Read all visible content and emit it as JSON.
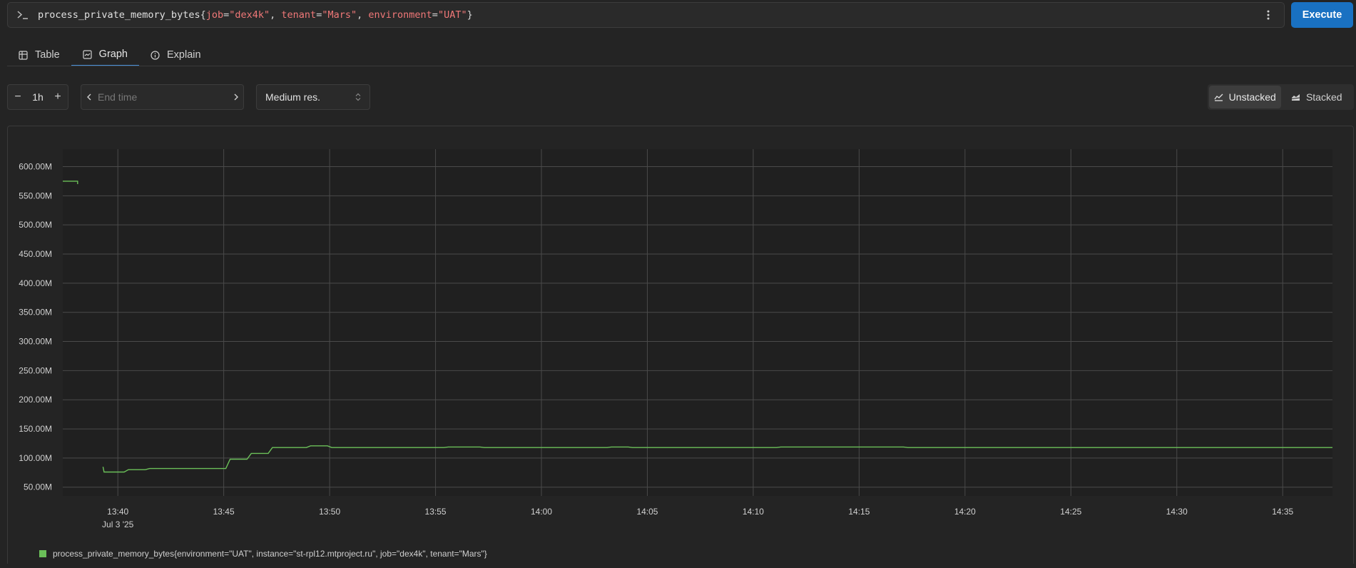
{
  "query": {
    "metric": "process_private_memory_bytes",
    "matchers": [
      {
        "key": "job",
        "value": "\"dex4k\""
      },
      {
        "key": "tenant",
        "value": "\"Mars\""
      },
      {
        "key": "environment",
        "value": "\"UAT\""
      }
    ]
  },
  "execute_label": "Execute",
  "tabs": [
    {
      "label": "Table",
      "icon": "table-icon"
    },
    {
      "label": "Graph",
      "icon": "graph-icon",
      "active": true
    },
    {
      "label": "Explain",
      "icon": "info-icon"
    }
  ],
  "controls": {
    "range": "1h",
    "end_time_placeholder": "End time",
    "resolution": "Medium res.",
    "unstacked_label": "Unstacked",
    "stacked_label": "Stacked"
  },
  "colors": {
    "accent": "#1971c2",
    "series": "#6bbf59"
  },
  "chart_data": {
    "type": "line",
    "y_ticks": [
      "50.00M",
      "100.00M",
      "150.00M",
      "200.00M",
      "250.00M",
      "300.00M",
      "350.00M",
      "400.00M",
      "450.00M",
      "500.00M",
      "550.00M",
      "600.00M"
    ],
    "y_tick_values": [
      50,
      100,
      150,
      200,
      250,
      300,
      350,
      400,
      450,
      500,
      550,
      600
    ],
    "ylim": [
      35,
      630
    ],
    "x_ticks": [
      "13:40",
      "13:45",
      "13:50",
      "13:55",
      "14:00",
      "14:05",
      "14:10",
      "14:15",
      "14:20",
      "14:25",
      "14:30",
      "14:35"
    ],
    "x_tick_minutes": [
      820,
      825,
      830,
      835,
      840,
      845,
      850,
      855,
      860,
      865,
      870,
      875
    ],
    "x_date_label": "Jul 3 '25",
    "xlim": [
      817.4,
      877.35
    ],
    "grid": true,
    "series": [
      {
        "name": "process_private_memory_bytes{environment=\"UAT\", instance=\"st-rpl12.mtproject.ru\", job=\"dex4k\", tenant=\"Mars\"}",
        "segments": [
          [
            [
              817.4,
              575
            ],
            [
              818.1,
              575
            ],
            [
              818.1,
              570
            ]
          ],
          [
            [
              819.3,
              85
            ],
            [
              819.35,
              76
            ],
            [
              820.3,
              76
            ],
            [
              820.5,
              80
            ],
            [
              821.3,
              80
            ],
            [
              821.5,
              82
            ],
            [
              825.1,
              82
            ],
            [
              825.3,
              98
            ],
            [
              826.1,
              98
            ],
            [
              826.3,
              108
            ],
            [
              827.1,
              108
            ],
            [
              827.3,
              118
            ],
            [
              828.9,
              118
            ],
            [
              829.1,
              121
            ],
            [
              829.9,
              121
            ],
            [
              830.1,
              118
            ],
            [
              835.4,
              118
            ],
            [
              835.6,
              119
            ],
            [
              837.1,
              119
            ],
            [
              837.3,
              118
            ],
            [
              843.1,
              118
            ],
            [
              843.3,
              119
            ],
            [
              844.1,
              119
            ],
            [
              844.3,
              118
            ],
            [
              851.1,
              118
            ],
            [
              851.3,
              119
            ],
            [
              857.1,
              119
            ],
            [
              857.3,
              118
            ],
            [
              877.35,
              118
            ]
          ]
        ]
      }
    ]
  }
}
